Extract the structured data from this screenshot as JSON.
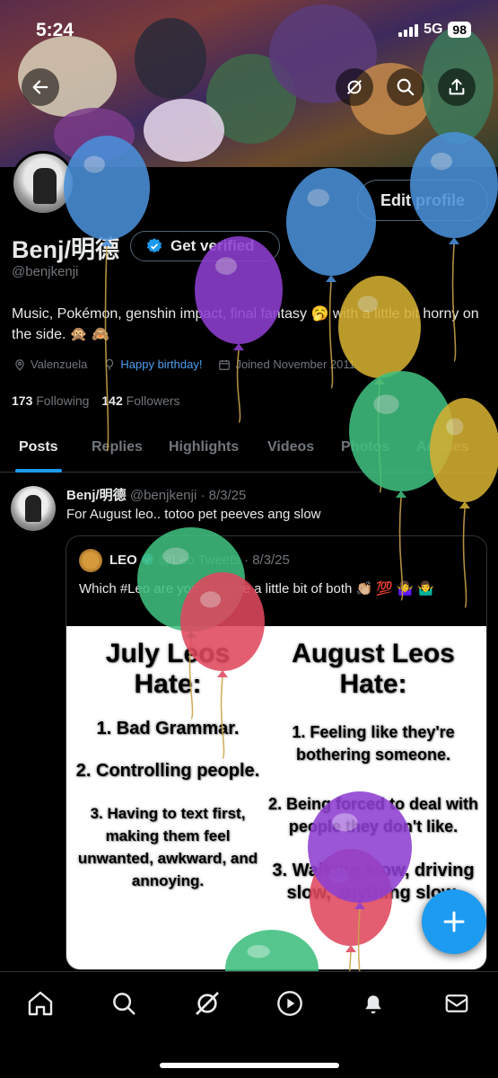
{
  "status": {
    "time": "5:24",
    "network": "5G",
    "battery": "98"
  },
  "profile": {
    "name": "Benj/明德",
    "handle": "@benjkenji",
    "edit_label": "Edit profile",
    "verify_label": "Get verified",
    "bio": "Music, Pokémon, genshin impact, final fantasy 🥱 with a little bit horny on the side. 🙊 🙈",
    "location": "Valenzuela",
    "birthday": "Happy birthday!",
    "joined": "Joined November 2011",
    "following_count": "173",
    "following_label": "Following",
    "followers_count": "142",
    "followers_label": "Followers"
  },
  "tabs": [
    "Posts",
    "Replies",
    "Highlights",
    "Videos",
    "Photos",
    "Articles"
  ],
  "post": {
    "author": "Benj/明德",
    "handle_date": "@benjkenji · 8/3/25",
    "text": "For August leo.. totoo pet peeves ang slow",
    "quote": {
      "author": "LEO",
      "handle_date": "@Leo Tweets · 8/3/25",
      "text": "Which #Leo are you? Maybe a little bit of both 👏🏼 💯 🤷‍♀️ 🤷‍♂️",
      "meme": {
        "left_title": "July Leos Hate:",
        "left_items": [
          "1. Bad Grammar.",
          "2. Controlling people.",
          "3. Having to text first, making them feel unwanted, awkward, and annoying."
        ],
        "right_title": "August Leos Hate:",
        "right_items": [
          "1. Feeling like they're bothering someone.",
          "2. Being forced to deal with people they don't like.",
          "3. Walking slow, driving slow, anything slow."
        ]
      }
    }
  },
  "colors": {
    "accent": "#1d9bf0",
    "birthday": "#4b9ff0",
    "muted": "#71767b"
  },
  "balloons": [
    {
      "color": "#4a90d9",
      "string": "#c9a34a"
    },
    {
      "color": "#4a90d9",
      "string": "#c9a34a"
    },
    {
      "color": "#4a90d9",
      "string": "#c9a34a"
    },
    {
      "color": "#8e3fd1",
      "string": "#c9a34a"
    },
    {
      "color": "#d4b032",
      "string": "#c9a34a"
    },
    {
      "color": "#3fbf7f",
      "string": "#c9a34a"
    },
    {
      "color": "#d4b032",
      "string": "#c9a34a"
    },
    {
      "color": "#3fbf7f",
      "string": "#c9a34a"
    },
    {
      "color": "#e0485e",
      "string": "#c9a34a"
    },
    {
      "color": "#e0485e",
      "string": "#c9a34a"
    },
    {
      "color": "#8e3fd1",
      "string": "#c9a34a"
    },
    {
      "color": "#3fbf7f",
      "string": "#c9a34a"
    }
  ],
  "nav_icons": [
    "home-icon",
    "search-icon",
    "grok-icon",
    "video-icon",
    "notifications-icon",
    "messages-icon"
  ]
}
